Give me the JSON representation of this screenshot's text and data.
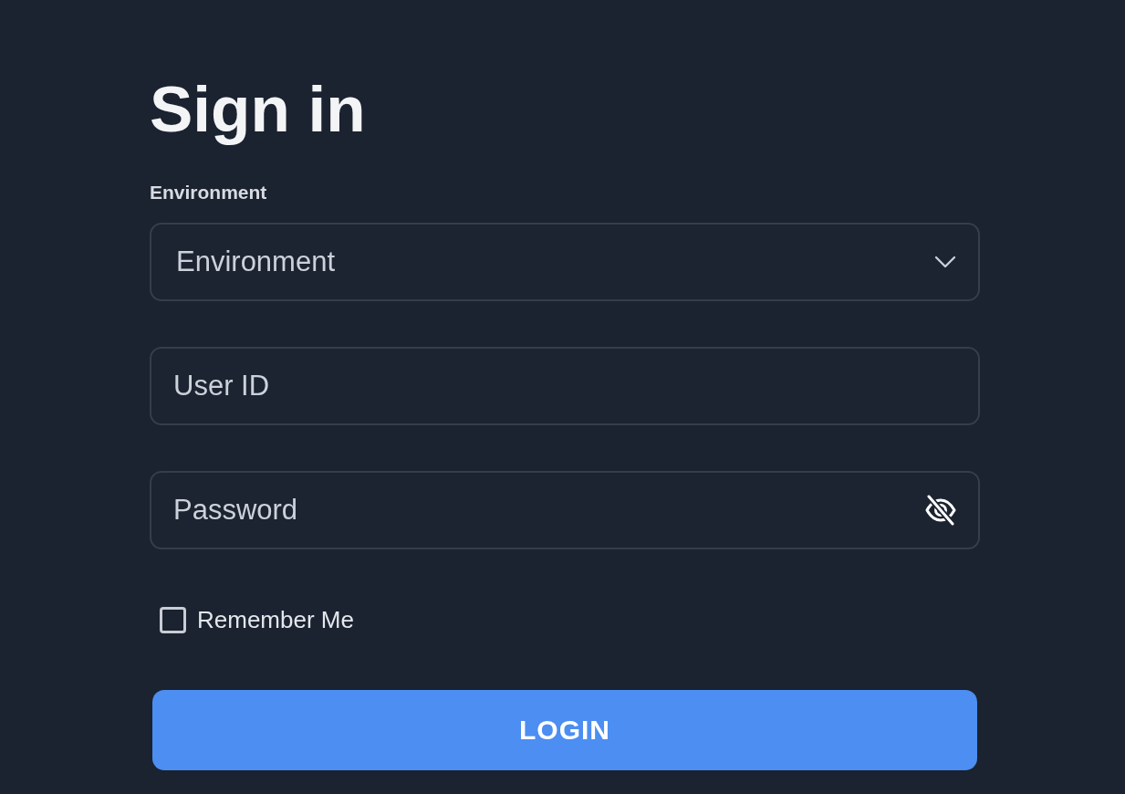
{
  "title": "Sign in",
  "environment": {
    "label": "Environment",
    "placeholder": "Environment"
  },
  "user_id": {
    "placeholder": "User ID"
  },
  "password": {
    "placeholder": "Password"
  },
  "remember_me": {
    "label": "Remember Me",
    "checked": false
  },
  "login_button": {
    "label": "LOGIN"
  }
}
